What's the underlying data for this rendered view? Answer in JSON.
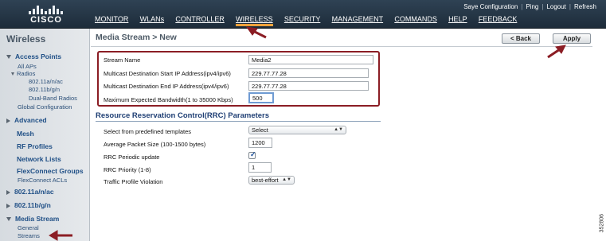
{
  "header": {
    "logo_text": "CISCO",
    "util_links": [
      "Saye Configuration",
      "Ping",
      "Logout",
      "Refresh"
    ],
    "nav_items": [
      "MONITOR",
      "WLANs",
      "CONTROLLER",
      "WIRELESS",
      "SECURITY",
      "MANAGEMENT",
      "COMMANDS",
      "HELP",
      "FEEDBACK"
    ],
    "active_nav": "WIRELESS",
    "accent_color": "#f0a23a"
  },
  "sidebar": {
    "title": "Wireless",
    "access_points": {
      "label": "Access Points",
      "all_aps": "All APs",
      "radios": "Radios",
      "radio_items": [
        "802.11a/n/ac",
        "802.11b/g/n",
        "Dual-Band Radios"
      ],
      "global_config": "Global Configuration"
    },
    "advanced": "Advanced",
    "mesh": "Mesh",
    "rf_profiles": "RF Profiles",
    "network_lists": "Network Lists",
    "flexconnect_groups": "FlexConnect Groups",
    "flexconnect_acls": "FlexConnect ACLs",
    "radio_a": "802.11a/n/ac",
    "radio_b": "802.11b/g/n",
    "media_stream": {
      "label": "Media Stream",
      "general": "General",
      "streams": "Streams"
    }
  },
  "main": {
    "title": "Media Stream > New",
    "back_button": "< Back",
    "apply_button": "Apply",
    "form": {
      "stream_name_label": "Stream Name",
      "stream_name_value": "Media2",
      "start_ip_label": "Multicast Destination Start IP Address(ipv4/ipv6)",
      "start_ip_value": "229.77.77.28",
      "end_ip_label": "Multicast Destination End IP Address(ipv4/ipv6)",
      "end_ip_value": "229.77.77.28",
      "bandwidth_label": "Maximum Expected Bandwidth(1 to 35000 Kbps)",
      "bandwidth_value": "500"
    },
    "rrc": {
      "title": "Resource Reservation Control(RRC) Parameters",
      "template_label": "Select from predefined templates",
      "template_value": "Select",
      "packet_size_label": "Average Packet Size (100-1500 bytes)",
      "packet_size_value": "1200",
      "periodic_label": "RRC Periodic update",
      "periodic_checked": true,
      "priority_label": "RRC Priority (1-8)",
      "priority_value": "1",
      "violation_label": "Traffic Profile Violation",
      "violation_value": "best-effort"
    }
  },
  "figure_code": "352806",
  "annotation_color": "#8b1d24"
}
